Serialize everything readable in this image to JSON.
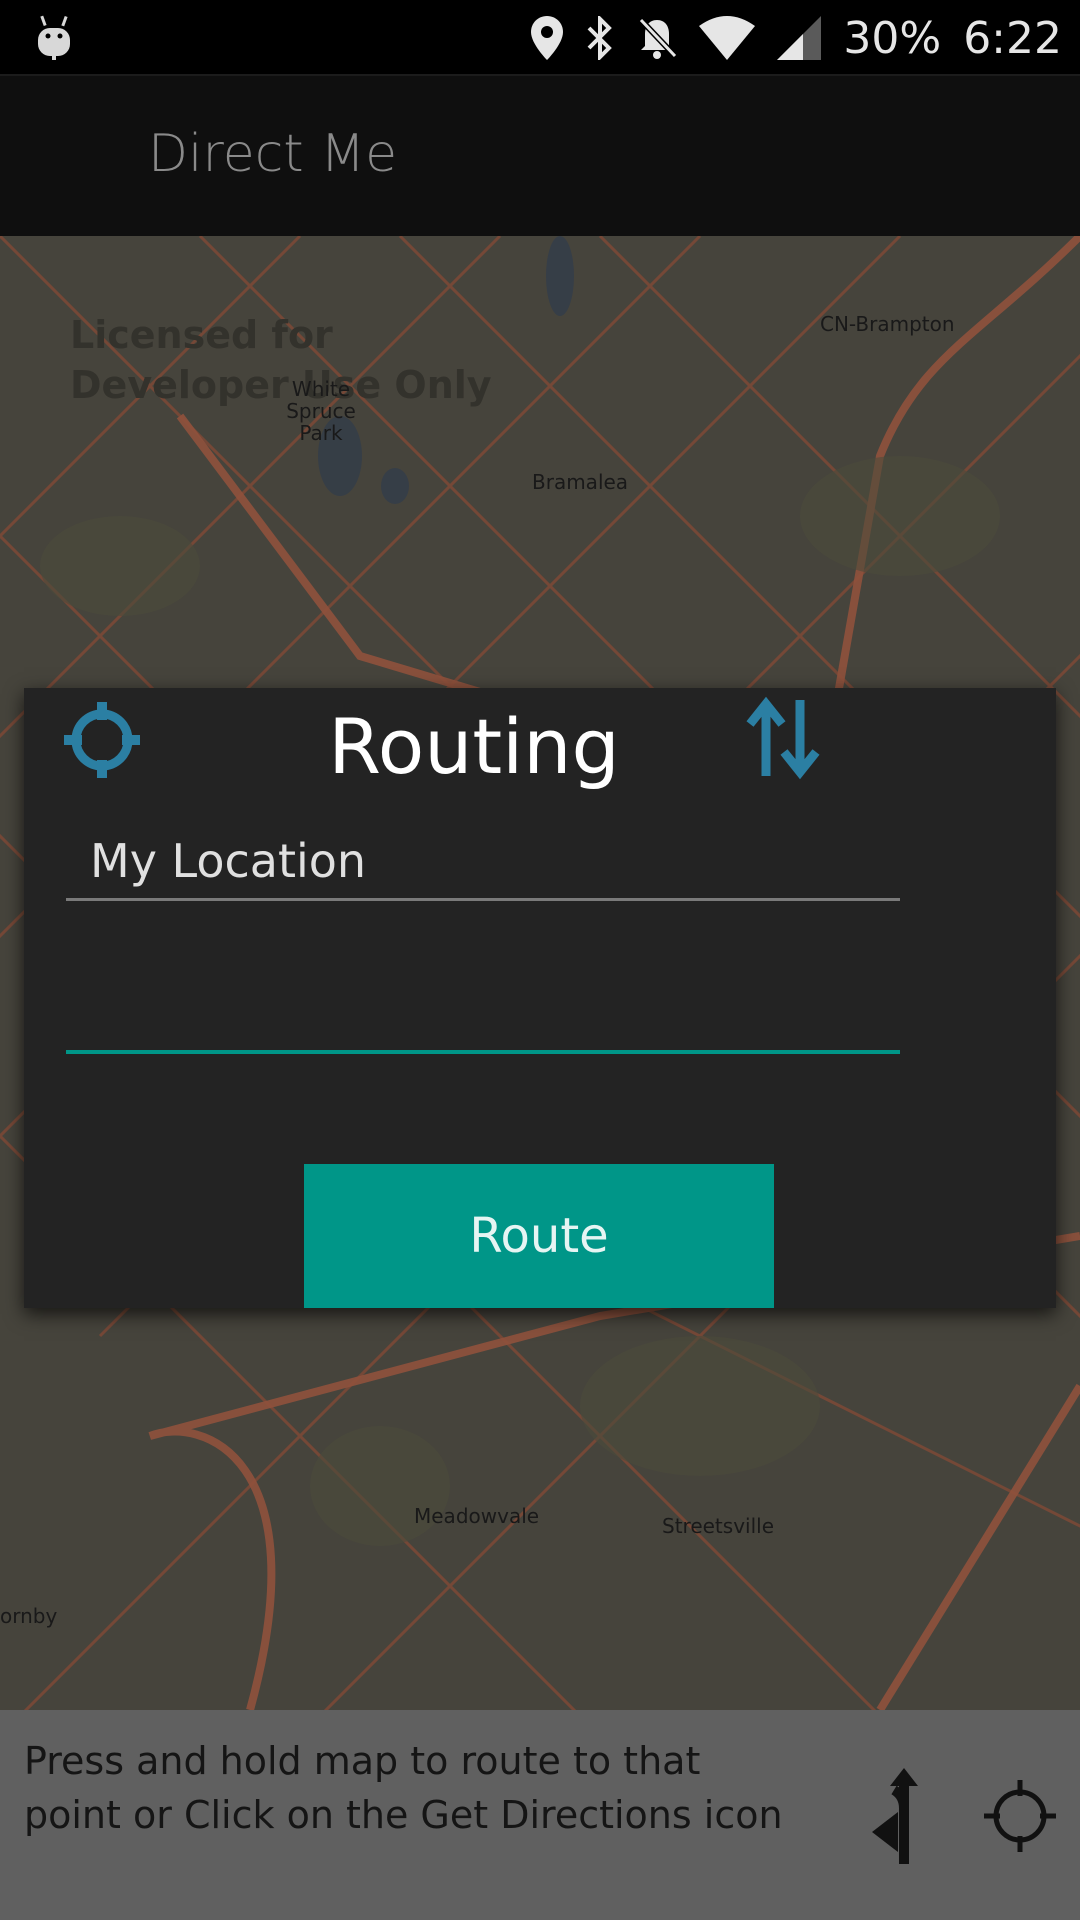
{
  "status_bar": {
    "battery": "30%",
    "time": "6:22",
    "icons": [
      "android-icon",
      "location-pin-icon",
      "bluetooth-icon",
      "notifications-off-icon",
      "wifi-icon",
      "signal-icon"
    ]
  },
  "app_bar": {
    "title": "Direct Me"
  },
  "map": {
    "license_text": "Licensed for Developer Use Only",
    "labels": [
      "CN-Brampton",
      "Bramalea",
      "White Spruce Park",
      "Meadowvale",
      "Streetsville",
      "ornby"
    ],
    "colors": {
      "road": "#b0644a",
      "land": "#56534a"
    }
  },
  "dialog": {
    "title": "Routing",
    "from_value": "My Location",
    "to_value": "",
    "route_button": "Route",
    "accent": "#009688",
    "icon_color": "#2b7fa3"
  },
  "bottom": {
    "hint": "Press and hold map to route to that point or Click on the Get Directions icon"
  }
}
